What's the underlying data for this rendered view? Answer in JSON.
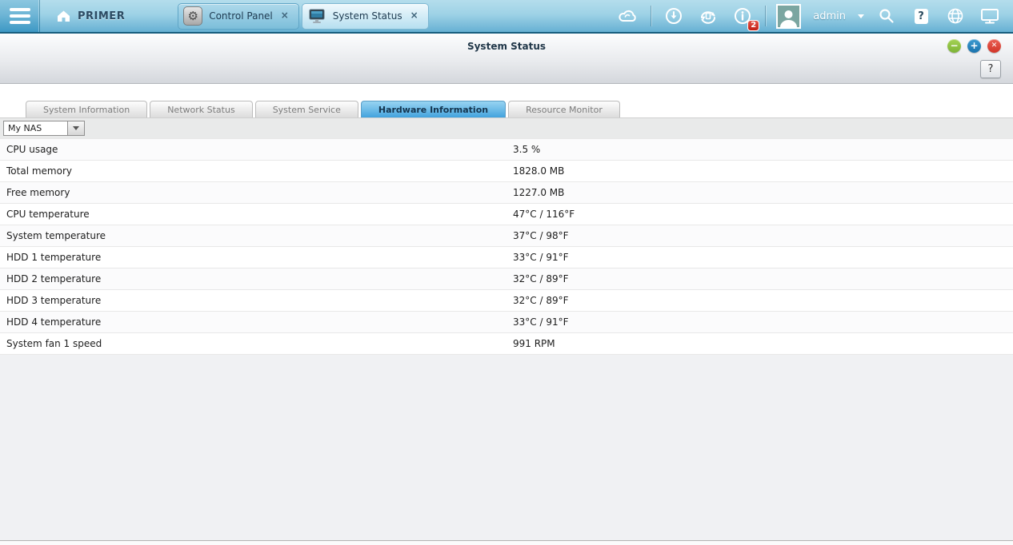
{
  "topbar": {
    "brand": "PRIMER",
    "window_tabs": [
      {
        "label": "Control Panel",
        "icon": "gear-icon",
        "active": false
      },
      {
        "label": "System Status",
        "icon": "monitor-icon",
        "active": true
      }
    ],
    "icons": [
      "cloud-icon",
      "background-task-icon",
      "sync-icon",
      "notifications-icon",
      "search-icon",
      "help-icon",
      "language-globe-icon",
      "desktop-icon"
    ],
    "username": "admin",
    "notification_count": "2"
  },
  "window": {
    "title": "System Status",
    "help": "?"
  },
  "content_tabs": [
    {
      "label": "System Information"
    },
    {
      "label": "Network Status"
    },
    {
      "label": "System Service"
    },
    {
      "label": "Hardware Information"
    },
    {
      "label": "Resource Monitor"
    }
  ],
  "active_content_tab": "Hardware Information",
  "nas_selector": {
    "value": "My NAS"
  },
  "hardware_info": {
    "rows": [
      {
        "label": "CPU usage",
        "value": "3.5 %"
      },
      {
        "label": "Total memory",
        "value": "1828.0 MB"
      },
      {
        "label": "Free memory",
        "value": "1227.0 MB"
      },
      {
        "label": "CPU temperature",
        "value": "47°C / 116°F"
      },
      {
        "label": "System temperature",
        "value": "37°C / 98°F"
      },
      {
        "label": "HDD 1 temperature",
        "value": "33°C / 91°F"
      },
      {
        "label": "HDD 2 temperature",
        "value": "32°C / 89°F"
      },
      {
        "label": "HDD 3 temperature",
        "value": "32°C / 89°F"
      },
      {
        "label": "HDD 4 temperature",
        "value": "33°C / 91°F"
      },
      {
        "label": "System fan 1 speed",
        "value": "991 RPM"
      }
    ]
  },
  "colors": {
    "topbar_blue": "#66b0d3",
    "active_tab_blue": "#42a2dd",
    "minimize_green": "#8dc63f",
    "maximize_blue": "#1f83c2",
    "close_red": "#d23427",
    "badge_red": "#c21f14",
    "content_bg": "#f0f1f3"
  }
}
